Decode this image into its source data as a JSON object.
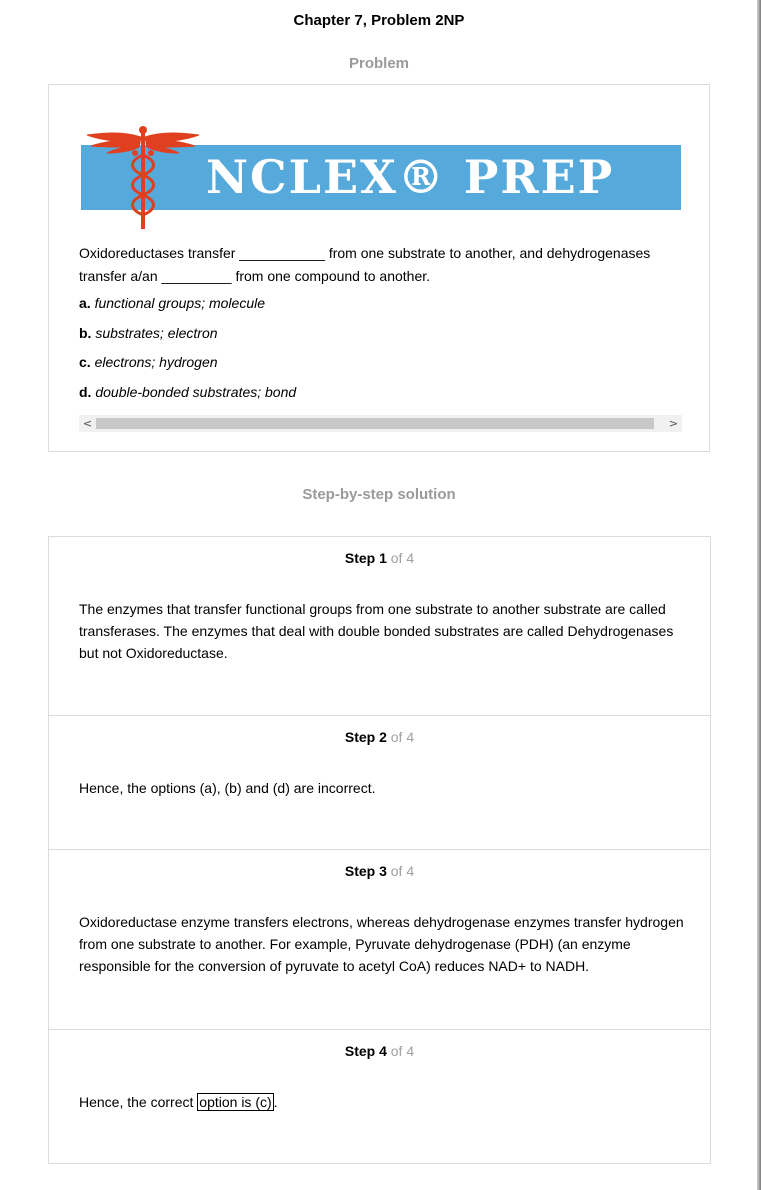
{
  "header": {
    "chapter_title": "Chapter 7, Problem 2NP",
    "problem_heading": "Problem",
    "solution_heading": "Step-by-step solution"
  },
  "banner": {
    "text": "NCLEX® PREP",
    "colors": {
      "bar": "#56aadb",
      "caduceus": "#e0401f",
      "text": "#ffffff"
    },
    "icon": "caduceus-icon"
  },
  "problem": {
    "question": "Oxidoreductases transfer ___________ from one substrate to another, and dehydrogenases transfer a/an _________ from one compound to another.",
    "options": [
      {
        "letter": "a.",
        "text": "functional groups; molecule"
      },
      {
        "letter": "b.",
        "text": "substrates; electron"
      },
      {
        "letter": "c.",
        "text": "electrons; hydrogen"
      },
      {
        "letter": "d.",
        "text": "double-bonded substrates; bond"
      }
    ],
    "scroll_left": "<",
    "scroll_right": ">"
  },
  "steps": [
    {
      "label": "Step 1",
      "of": "of 4",
      "body": "The enzymes that transfer functional groups from one substrate to another substrate are called transferases. The enzymes that deal with double bonded substrates are called Dehydrogenases but not Oxidoreductase."
    },
    {
      "label": "Step 2",
      "of": "of 4",
      "body": "Hence, the options (a), (b) and (d) are incorrect."
    },
    {
      "label": "Step 3",
      "of": "of 4",
      "body": "Oxidoreductase enzyme transfers electrons, whereas dehydrogenase enzymes transfer hydrogen from one substrate to another. For example, Pyruvate dehydrogenase (PDH) (an enzyme responsible for the conversion of pyruvate to acetyl CoA) reduces NAD+ to NADH."
    },
    {
      "label": "Step 4",
      "of": "of 4",
      "body_prefix": "Hence, the correct ",
      "body_boxed": "option is (c)",
      "body_suffix": "."
    }
  ]
}
